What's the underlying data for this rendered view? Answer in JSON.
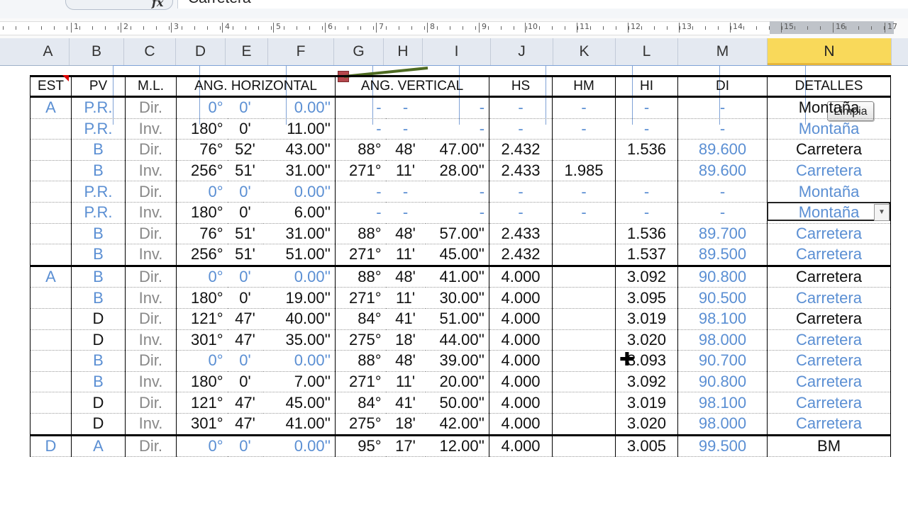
{
  "formula_bar": {
    "fx_label": "fx",
    "value": "Carretera"
  },
  "ruler": {
    "numbers": [
      "1",
      "2",
      "3",
      "4",
      "5",
      "6",
      "7",
      "8",
      "9",
      "10",
      "11",
      "12",
      "13",
      "14",
      "15",
      "16",
      "17"
    ]
  },
  "columns": [
    "A",
    "B",
    "C",
    "D",
    "E",
    "F",
    "G",
    "H",
    "I",
    "J",
    "K",
    "L",
    "M",
    "N"
  ],
  "selected_column": "N",
  "button": {
    "label": "Limpia"
  },
  "table": {
    "headers": [
      "EST",
      "PV",
      "M.L.",
      "ANG. HORIZONTAL",
      "ANG. VERTICAL",
      "HS",
      "HM",
      "HI",
      "DI",
      "DETALLES"
    ],
    "rows": [
      {
        "est": "A",
        "pv": "P.R.",
        "ml": "Dir.",
        "h1": "0°",
        "h2": "0'",
        "h3": "0.00''",
        "v1": "-",
        "v2": "-",
        "v3": "-",
        "hs": "-",
        "hm": "-",
        "hi": "-",
        "di": "-",
        "det": "Montaña",
        "c": "bb",
        "dc": "k"
      },
      {
        "est": "",
        "pv": "P.R.",
        "ml": "Inv.",
        "h1": "180°",
        "h2": "0'",
        "h3": "11.00''",
        "v1": "-",
        "v2": "-",
        "v3": "-",
        "hs": "-",
        "hm": "-",
        "hi": "-",
        "di": "-",
        "det": "Montaña",
        "c": "bk",
        "dc": "b"
      },
      {
        "est": "",
        "pv": "B",
        "ml": "Dir.",
        "h1": "76°",
        "h2": "52'",
        "h3": "43.00''",
        "v1": "88°",
        "v2": "48'",
        "v3": "47.00''",
        "hs": "2.432",
        "hm": "",
        "hi": "1.536",
        "di": "89.600",
        "det": "Carretera",
        "c": "bk",
        "dc": "k"
      },
      {
        "est": "",
        "pv": "B",
        "ml": "Inv.",
        "h1": "256°",
        "h2": "51'",
        "h3": "31.00''",
        "v1": "271°",
        "v2": "11'",
        "v3": "28.00''",
        "hs": "2.433",
        "hm": "1.985",
        "hi": "",
        "di": "89.600",
        "det": "Carretera",
        "c": "bk",
        "dc": "b"
      },
      {
        "est": "",
        "pv": "P.R.",
        "ml": "Dir.",
        "h1": "0°",
        "h2": "0'",
        "h3": "0.00''",
        "v1": "-",
        "v2": "-",
        "v3": "-",
        "hs": "-",
        "hm": "-",
        "hi": "-",
        "di": "-",
        "det": "Montaña",
        "c": "bb",
        "dc": "b"
      },
      {
        "est": "",
        "pv": "P.R.",
        "ml": "Inv.",
        "h1": "180°",
        "h2": "0'",
        "h3": "6.00''",
        "v1": "-",
        "v2": "-",
        "v3": "-",
        "hs": "-",
        "hm": "-",
        "hi": "-",
        "di": "-",
        "det": "Montaña",
        "c": "bk",
        "dc": "b"
      },
      {
        "est": "",
        "pv": "B",
        "ml": "Dir.",
        "h1": "76°",
        "h2": "51'",
        "h3": "31.00''",
        "v1": "88°",
        "v2": "48'",
        "v3": "57.00''",
        "hs": "2.433",
        "hm": "",
        "hi": "1.536",
        "di": "89.700",
        "det": "Carretera",
        "c": "bk",
        "dc": "b"
      },
      {
        "est": "",
        "pv": "B",
        "ml": "Inv.",
        "h1": "256°",
        "h2": "51'",
        "h3": "51.00''",
        "v1": "271°",
        "v2": "11'",
        "v3": "45.00''",
        "hs": "2.432",
        "hm": "",
        "hi": "1.537",
        "di": "89.500",
        "det": "Carretera",
        "c": "bk",
        "dc": "b"
      },
      {
        "est": "A",
        "pv": "B",
        "ml": "Dir.",
        "h1": "0°",
        "h2": "0'",
        "h3": "0.00''",
        "v1": "88°",
        "v2": "48'",
        "v3": "41.00''",
        "hs": "4.000",
        "hm": "",
        "hi": "3.092",
        "di": "90.800",
        "det": "Carretera",
        "c": "bb",
        "dc": "k",
        "g": 1
      },
      {
        "est": "",
        "pv": "B",
        "ml": "Inv.",
        "h1": "180°",
        "h2": "0'",
        "h3": "19.00''",
        "v1": "271°",
        "v2": "11'",
        "v3": "30.00''",
        "hs": "4.000",
        "hm": "",
        "hi": "3.095",
        "di": "90.500",
        "det": "Carretera",
        "c": "bk",
        "dc": "b"
      },
      {
        "est": "",
        "pv": "D",
        "ml": "Dir.",
        "h1": "121°",
        "h2": "47'",
        "h3": "40.00''",
        "v1": "84°",
        "v2": "41'",
        "v3": "51.00''",
        "hs": "4.000",
        "hm": "",
        "hi": "3.019",
        "di": "98.100",
        "det": "Carretera",
        "c": "kk",
        "dc": "k"
      },
      {
        "est": "",
        "pv": "D",
        "ml": "Inv.",
        "h1": "301°",
        "h2": "47'",
        "h3": "35.00''",
        "v1": "275°",
        "v2": "18'",
        "v3": "44.00''",
        "hs": "4.000",
        "hm": "",
        "hi": "3.020",
        "di": "98.000",
        "det": "Carretera",
        "c": "kk",
        "dc": "b"
      },
      {
        "est": "",
        "pv": "B",
        "ml": "Dir.",
        "h1": "0°",
        "h2": "0'",
        "h3": "0.00''",
        "v1": "88°",
        "v2": "48'",
        "v3": "39.00''",
        "hs": "4.000",
        "hm": "",
        "hi": "3.093",
        "di": "90.700",
        "det": "Carretera",
        "c": "bb",
        "dc": "b"
      },
      {
        "est": "",
        "pv": "B",
        "ml": "Inv.",
        "h1": "180°",
        "h2": "0'",
        "h3": "7.00''",
        "v1": "271°",
        "v2": "11'",
        "v3": "20.00''",
        "hs": "4.000",
        "hm": "",
        "hi": "3.092",
        "di": "90.800",
        "det": "Carretera",
        "c": "bk",
        "dc": "b"
      },
      {
        "est": "",
        "pv": "D",
        "ml": "Dir.",
        "h1": "121°",
        "h2": "47'",
        "h3": "45.00''",
        "v1": "84°",
        "v2": "41'",
        "v3": "50.00''",
        "hs": "4.000",
        "hm": "",
        "hi": "3.019",
        "di": "98.100",
        "det": "Carretera",
        "c": "kk",
        "dc": "b"
      },
      {
        "est": "",
        "pv": "D",
        "ml": "Inv.",
        "h1": "301°",
        "h2": "47'",
        "h3": "41.00''",
        "v1": "275°",
        "v2": "18'",
        "v3": "42.00''",
        "hs": "4.000",
        "hm": "",
        "hi": "3.020",
        "di": "98.000",
        "det": "Carretera",
        "c": "kk",
        "dc": "b"
      },
      {
        "est": "D",
        "pv": "A",
        "ml": "Dir.",
        "h1": "0°",
        "h2": "0'",
        "h3": "0.00''",
        "v1": "95°",
        "v2": "17'",
        "v3": "12.00''",
        "hs": "4.000",
        "hm": "",
        "hi": "3.005",
        "di": "99.500",
        "det": "BM",
        "c": "bb",
        "dc": "k",
        "g": 1
      }
    ]
  },
  "colors": {
    "blue": "#5b8fd3",
    "header_bg": "#e4e9f1",
    "selected_col": "#f9d95a"
  }
}
